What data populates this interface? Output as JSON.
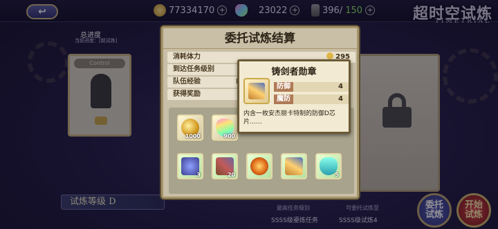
{
  "topbar": {
    "back_label": "↩",
    "gold": "77334170",
    "gems": "23022",
    "stamina_current": "396/",
    "stamina_max": "150",
    "event_title": "超时空试炼",
    "event_subtitle": "TIMETRIAL"
  },
  "left": {
    "progress_label": "总进度",
    "progress_sub": "当前进度：[超试炼]",
    "card_ribbon": "Control",
    "trial_level": "试炼等级 D"
  },
  "footer": {
    "note1": "最高任务级别",
    "note2": "可委托试炼至",
    "sub1": "SSSS级鎏炼任务",
    "sub2": "SSSS级试炼4"
  },
  "buttons": {
    "entrust": "委托\n试炼",
    "start": "开始\n试炼"
  },
  "modal": {
    "title": "委托试炼结算",
    "rows": [
      {
        "label": "消耗体力",
        "value": "295"
      },
      {
        "label": "到达任务级别",
        "value": ""
      },
      {
        "label": "队伍经验",
        "value": "Lv"
      },
      {
        "label": "获得奖励",
        "value": ""
      }
    ],
    "items": [
      {
        "name": "gold-coin",
        "count": "1000"
      },
      {
        "name": "rainbow-gem",
        "count": "900"
      },
      {
        "name": "armor-gear",
        "count": "3"
      },
      {
        "name": "crossbow-gear",
        "count": "20"
      },
      {
        "name": "sun-emblem",
        "count": ""
      },
      {
        "name": "sword-medal",
        "count": ""
      },
      {
        "name": "crystal-shield",
        "count": "5"
      }
    ]
  },
  "tooltip": {
    "title": "铸剑者勋章",
    "stats": [
      {
        "label": "防御",
        "value": "4"
      },
      {
        "label": "魔防",
        "value": "4"
      }
    ],
    "description": "内含一枚安杰丽卡特制的防御D芯片……"
  }
}
